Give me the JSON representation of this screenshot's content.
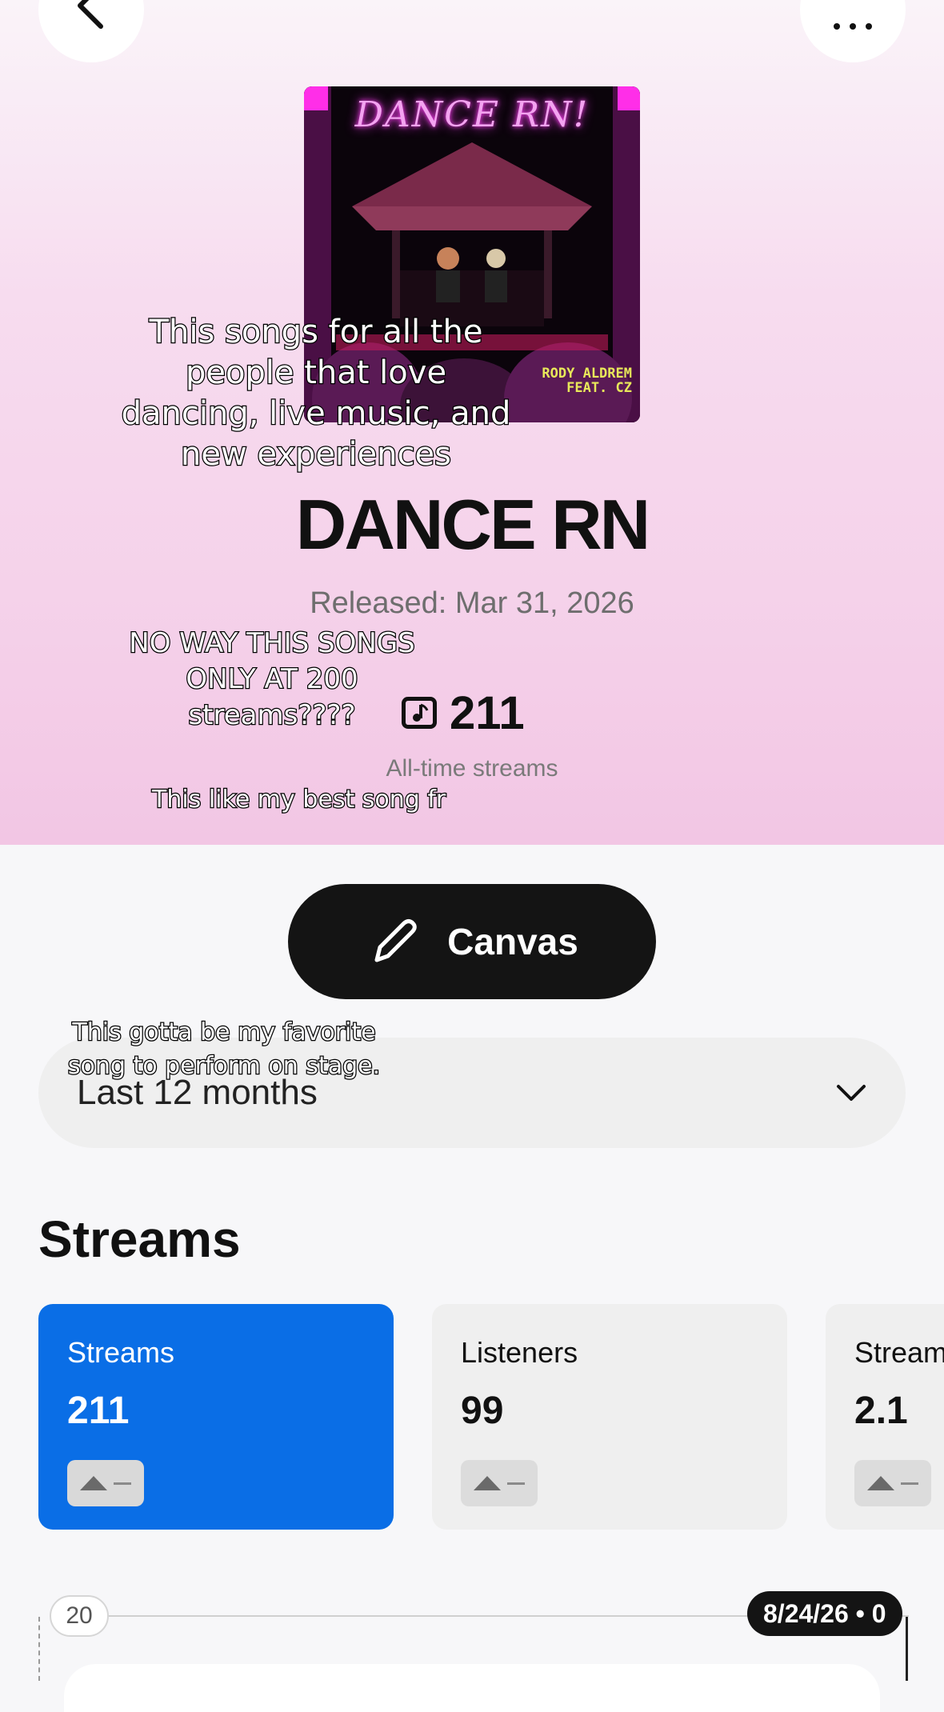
{
  "song": {
    "cover_title": "DANCE RN!",
    "cover_credit_line1": "RODY ALDREM",
    "cover_credit_line2": "FEAT. CZ",
    "title": "DANCE RN",
    "released": "Released: Mar 31, 2026",
    "all_time_streams": "211",
    "all_time_label": "All-time streams"
  },
  "overlays": {
    "caption1": "This songs for all the people that love dancing, live music, and new experiences",
    "caption2": "NO WAY THIS SONGS ONLY AT 200 streams????",
    "caption3": "This like my best song fr",
    "caption4": "This gotta be my favorite song to perform on stage."
  },
  "canvas_button": {
    "label": "Canvas"
  },
  "period_select": {
    "value": "Last 12 months"
  },
  "streams_section": {
    "title": "Streams",
    "cards": [
      {
        "label": "Streams",
        "value": "211"
      },
      {
        "label": "Listeners",
        "value": "99"
      },
      {
        "label": "Stream",
        "value": "2.1"
      }
    ]
  },
  "chart": {
    "y_tick": "20",
    "tooltip": "8/24/26 • 0"
  }
}
